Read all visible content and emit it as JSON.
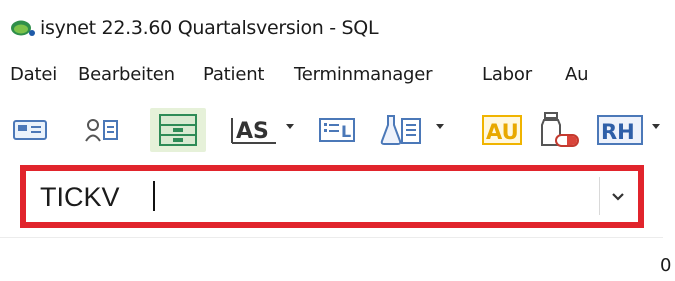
{
  "window": {
    "title": "isynet 22.3.60 Quartalsversion - SQL",
    "logo_icon": "isynet-logo-icon"
  },
  "menu": {
    "items": [
      "Datei",
      "Bearbeiten",
      "Patient",
      "Terminmanager",
      "Labor",
      "Au"
    ]
  },
  "toolbar": {
    "buttons": [
      {
        "icon": "card-reader-icon"
      },
      {
        "icon": "patient-list-icon"
      },
      {
        "icon": "folder-cabinet-icon",
        "active": true
      },
      {
        "label": "AS",
        "icon": "as-form-icon",
        "dropdown": true
      },
      {
        "icon": "list-document-icon"
      },
      {
        "icon": "lab-flask-document-icon",
        "dropdown": true
      },
      {
        "label": "AU",
        "icon": "au-sick-note-icon"
      },
      {
        "icon": "medication-bottle-icon"
      },
      {
        "label": "RH",
        "icon": "rh-prescription-icon",
        "dropdown": true
      }
    ]
  },
  "search": {
    "value": "TICKV",
    "highlight_color": "#e1242c"
  },
  "footer": {
    "text": "0"
  }
}
